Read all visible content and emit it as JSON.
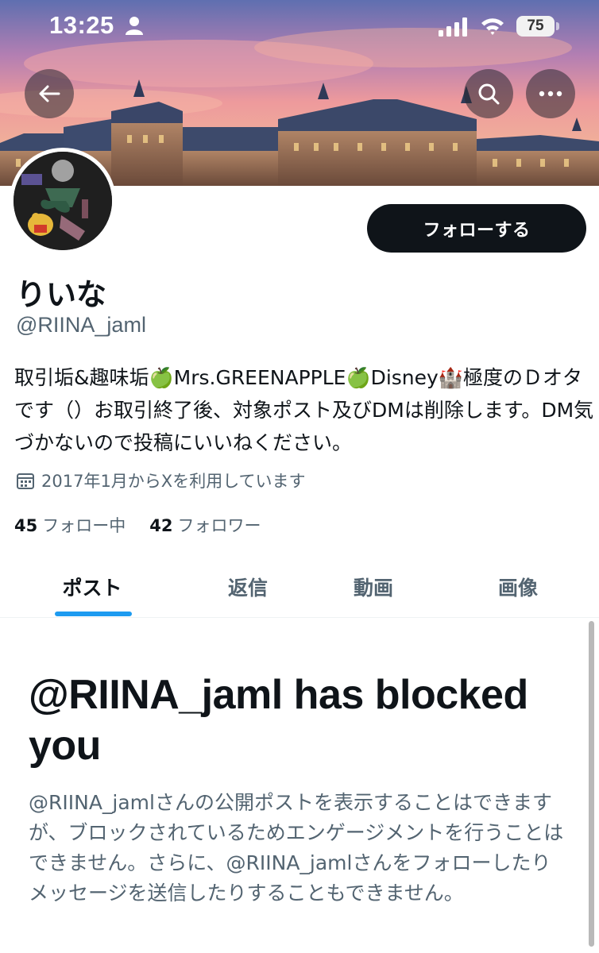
{
  "status_bar": {
    "time": "13:25",
    "battery": "75"
  },
  "header": {
    "icons": {
      "back": "back-arrow-icon",
      "search": "search-icon",
      "more": "more-icon"
    }
  },
  "profile": {
    "display_name": "りいな",
    "handle": "@RIINA_jaml",
    "follow_label": "フォローする",
    "bio": "取引垢&趣味垢🍏Mrs.GREENAPPLE🍏Disney🏰極度のＤオタです（）お取引終了後、対象ポスト及びDMは削除します。DM気づかないので投稿にいいねください。",
    "joined": "2017年1月からXを利用しています",
    "following_count": "45",
    "following_label": "フォロー中",
    "followers_count": "42",
    "followers_label": "フォロワー"
  },
  "tabs": [
    {
      "label": "ポスト",
      "active": true
    },
    {
      "label": "返信",
      "active": false
    },
    {
      "label": "動画",
      "active": false
    },
    {
      "label": "画像",
      "active": false
    }
  ],
  "blocked": {
    "title": "@RIINA_jaml has blocked you",
    "message": "@RIINA_jamlさんの公開ポストを表示することはできますが、ブロックされているためエンゲージメントを行うことはできません。さらに、@RIINA_jamlさんをフォローしたりメッセージを送信したりすることもできません。"
  },
  "colors": {
    "accent": "#1d9bf0",
    "text_primary": "#0f1419",
    "text_secondary": "#536471",
    "button_dark": "#0f1419"
  }
}
